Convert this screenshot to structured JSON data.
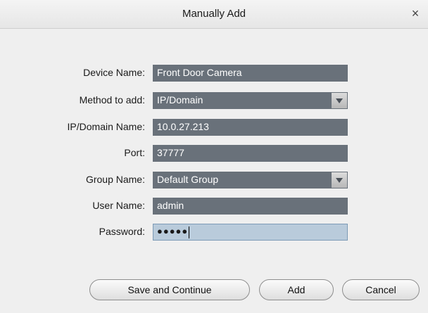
{
  "dialog": {
    "title": "Manually Add",
    "close_symbol": "×"
  },
  "form": {
    "device_name": {
      "label": "Device Name:",
      "value": "Front Door Camera"
    },
    "method": {
      "label": "Method to add:",
      "value": "IP/Domain",
      "icon": "dropdown-arrow-icon"
    },
    "ip_domain": {
      "label": "IP/Domain Name:",
      "value": "10.0.27.213"
    },
    "port": {
      "label": "Port:",
      "value": "37777"
    },
    "group": {
      "label": "Group Name:",
      "value": "Default Group",
      "icon": "dropdown-arrow-icon"
    },
    "user_name": {
      "label": "User Name:",
      "value": "admin"
    },
    "password": {
      "label": "Password:",
      "masked_value": "●●●●●"
    }
  },
  "buttons": {
    "save_continue": "Save and Continue",
    "add": "Add",
    "cancel": "Cancel"
  },
  "colors": {
    "field_bg": "#69717a",
    "focused_field_bg": "#b9cbdb",
    "dialog_bg": "#efefef"
  }
}
